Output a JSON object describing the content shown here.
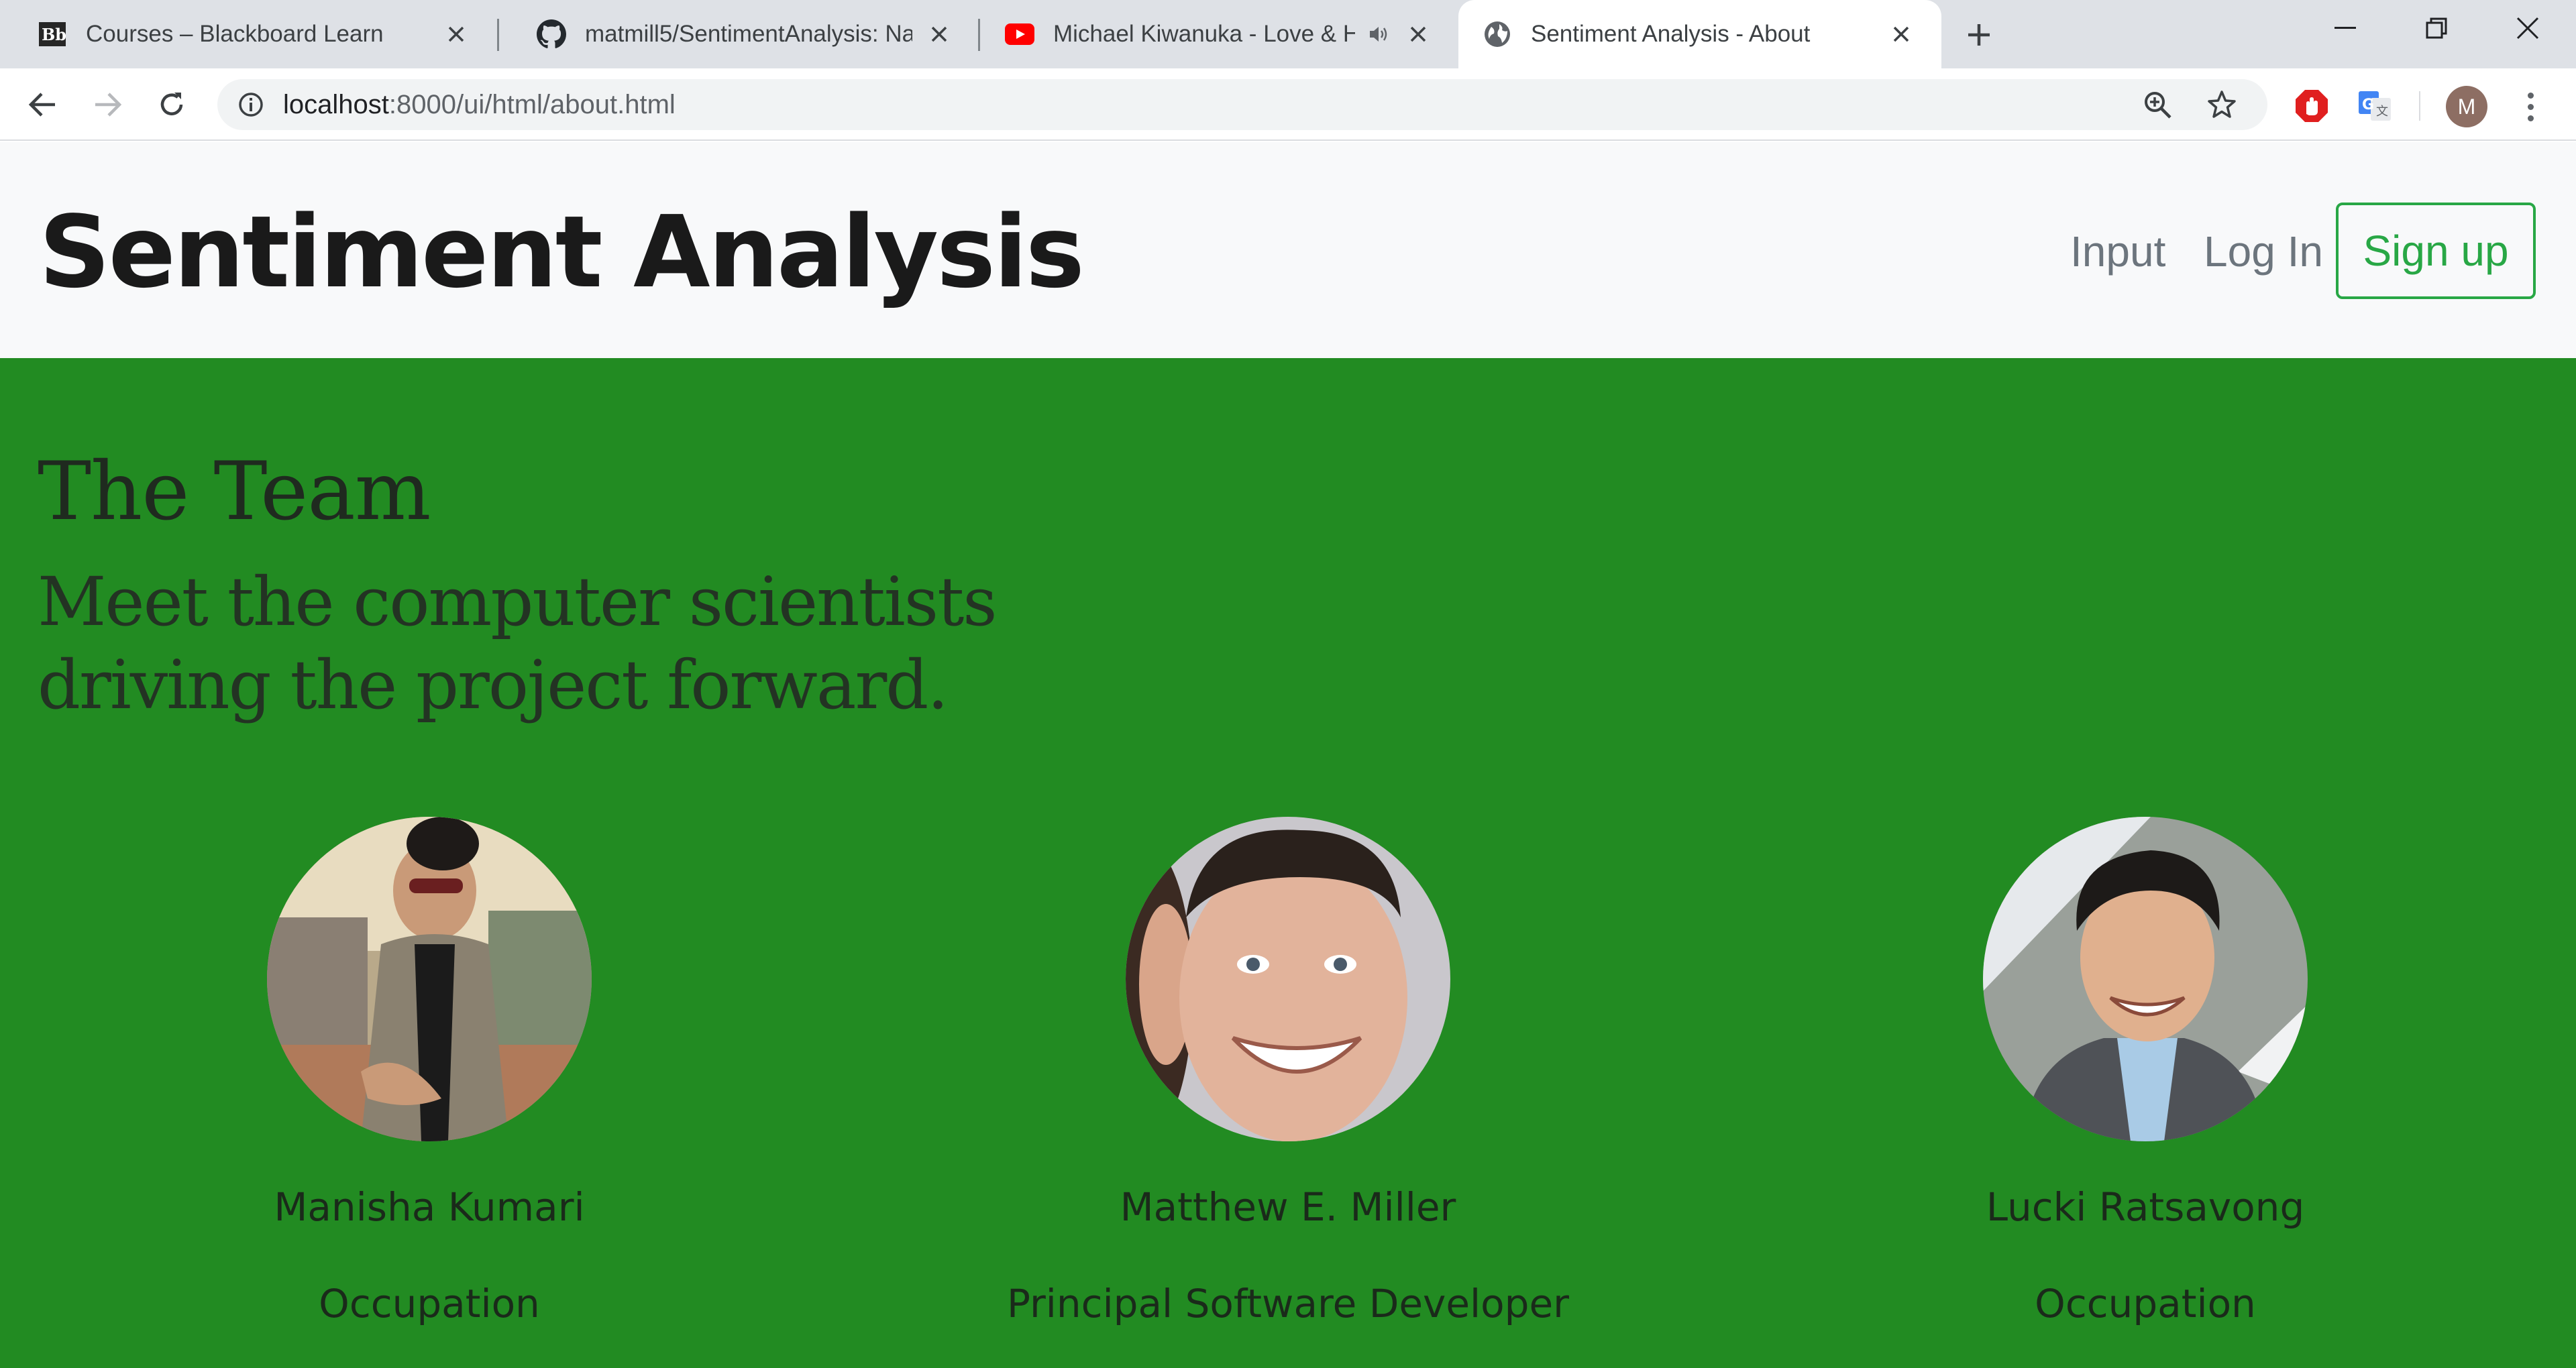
{
  "browser": {
    "tabs": [
      {
        "title": "Courses – Blackboard Learn",
        "favicon": "blackboard-icon",
        "active": false
      },
      {
        "title": "matmill5/SentimentAnalysis: Nat",
        "favicon": "github-icon",
        "active": false
      },
      {
        "title": "Michael Kiwanuka - Love & H",
        "favicon": "youtube-icon",
        "active": false,
        "audio": true
      },
      {
        "title": "Sentiment Analysis - About",
        "favicon": "globe-icon",
        "active": true
      }
    ],
    "url_host": "localhost",
    "url_path": ":8000/ui/html/about.html",
    "profile_initial": "M"
  },
  "navbar": {
    "brand": "Sentiment Analysis",
    "links": [
      "Input",
      "Log In"
    ],
    "signup_label": "Sign up"
  },
  "jumbotron": {
    "heading": "The Team",
    "lead": "Meet the computer scientists driving the project forward.",
    "background": "#228b22"
  },
  "team": [
    {
      "name": "Manisha Kumari",
      "role": "Occupation"
    },
    {
      "name": "Matthew E. Miller",
      "role": "Principal Software Developer"
    },
    {
      "name": "Lucki Ratsavong",
      "role": "Occupation"
    }
  ]
}
